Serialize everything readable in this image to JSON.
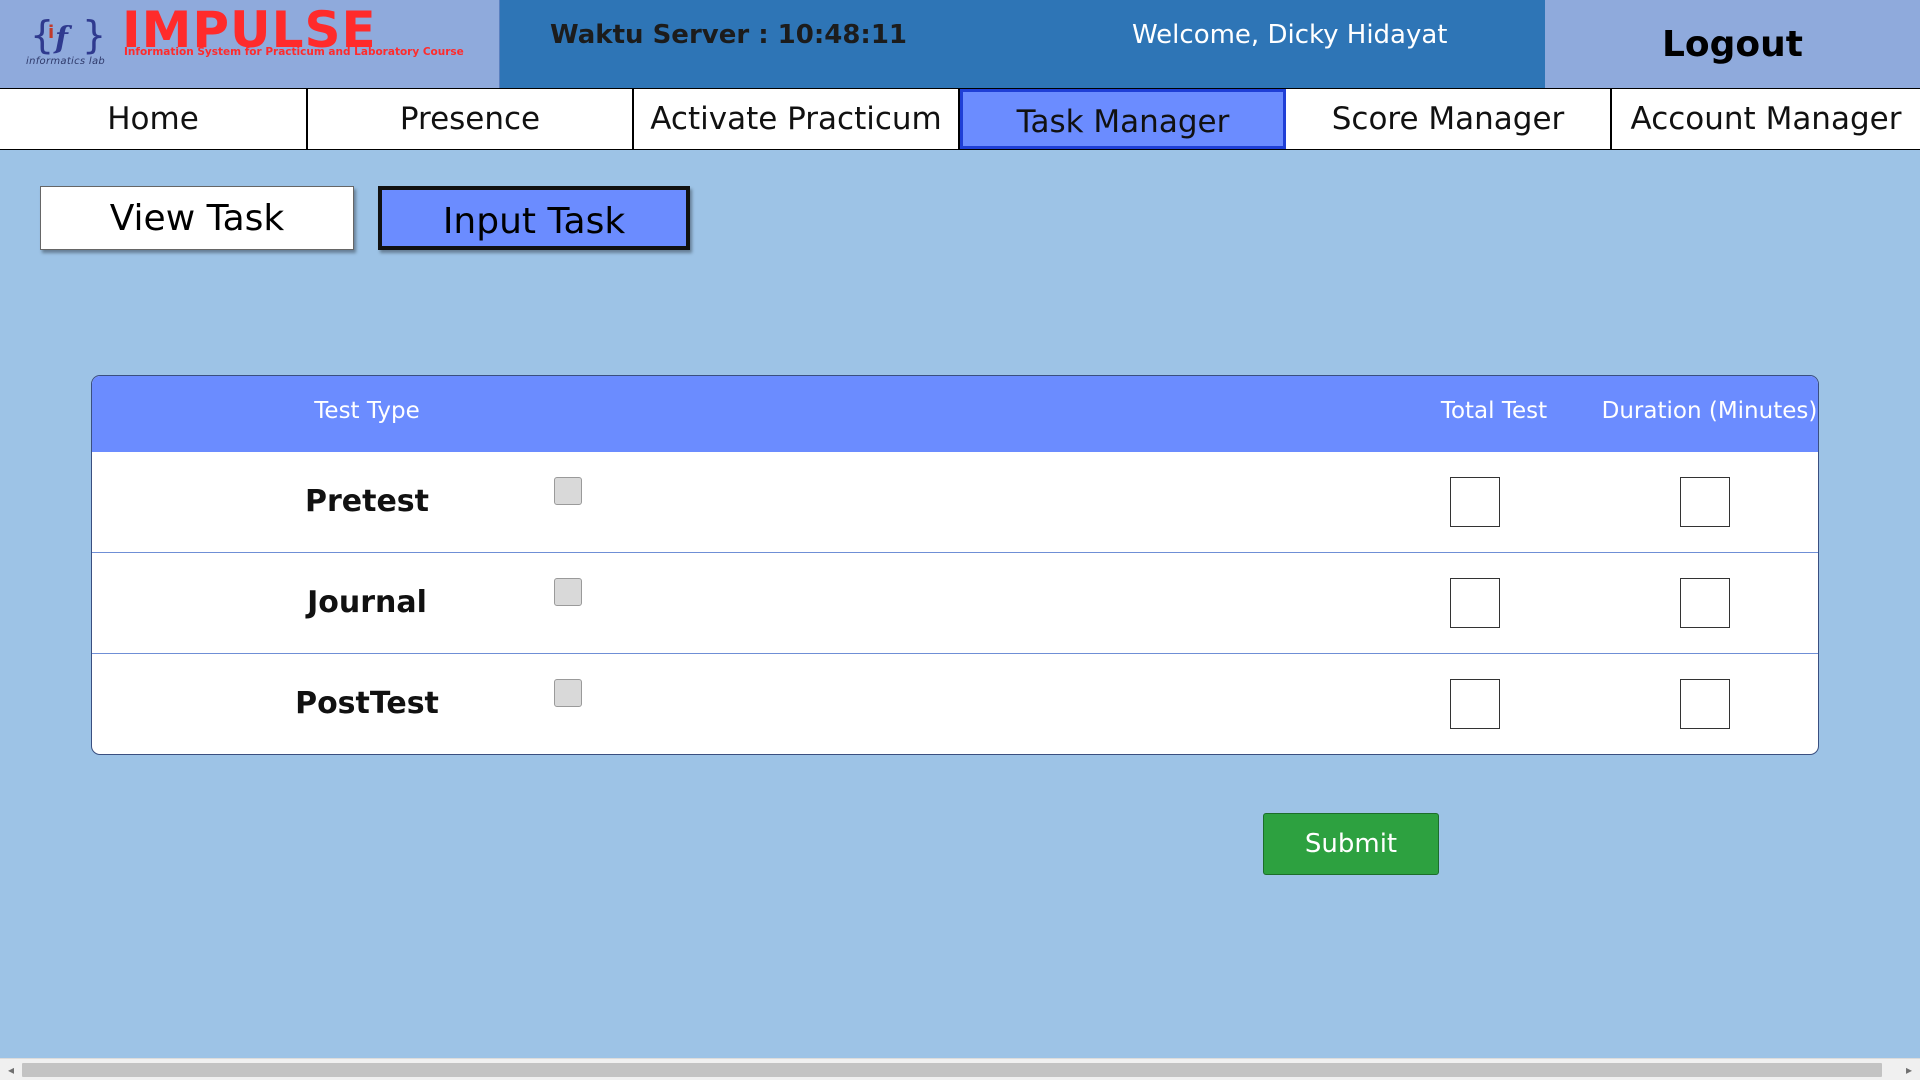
{
  "header": {
    "brand": {
      "logo_icon": "if-bracket-logo-icon",
      "logo_sub": "informatics lab",
      "title": "IMPULSE",
      "tagline": "Information System for Practicum and Laboratory Course"
    },
    "server_time": "Waktu Server : 10:48:11",
    "welcome": "Welcome, Dicky Hidayat",
    "logout_label": "Logout"
  },
  "nav": {
    "items": [
      {
        "label": "Home"
      },
      {
        "label": "Presence"
      },
      {
        "label": "Activate Practicum"
      },
      {
        "label": "Task Manager"
      },
      {
        "label": "Score Manager"
      },
      {
        "label": "Account Manager"
      }
    ],
    "active": "Task Manager"
  },
  "subtabs": {
    "view_label": "View Task",
    "input_label": "Input Task",
    "active": "Input Task"
  },
  "task_table": {
    "headers": {
      "type": "Test Type",
      "total": "Total Test",
      "duration": "Duration (Minutes)"
    },
    "rows": [
      {
        "label": "Pretest",
        "checked": false,
        "total": "",
        "duration": ""
      },
      {
        "label": "Journal",
        "checked": false,
        "total": "",
        "duration": ""
      },
      {
        "label": "PostTest",
        "checked": false,
        "total": "",
        "duration": ""
      }
    ]
  },
  "submit_label": "Submit",
  "scrollbar": {
    "left_arrow": "◂",
    "right_arrow": "▸"
  },
  "colors": {
    "page_bg": "#9dc3e6",
    "brand_bg": "#8faadc",
    "server_bar_bg": "#2e75b6",
    "active_nav_bg": "#6b8cff",
    "table_header_bg": "#6b8cff",
    "submit_bg": "#2da140",
    "logo_red": "#ff2b2b"
  }
}
